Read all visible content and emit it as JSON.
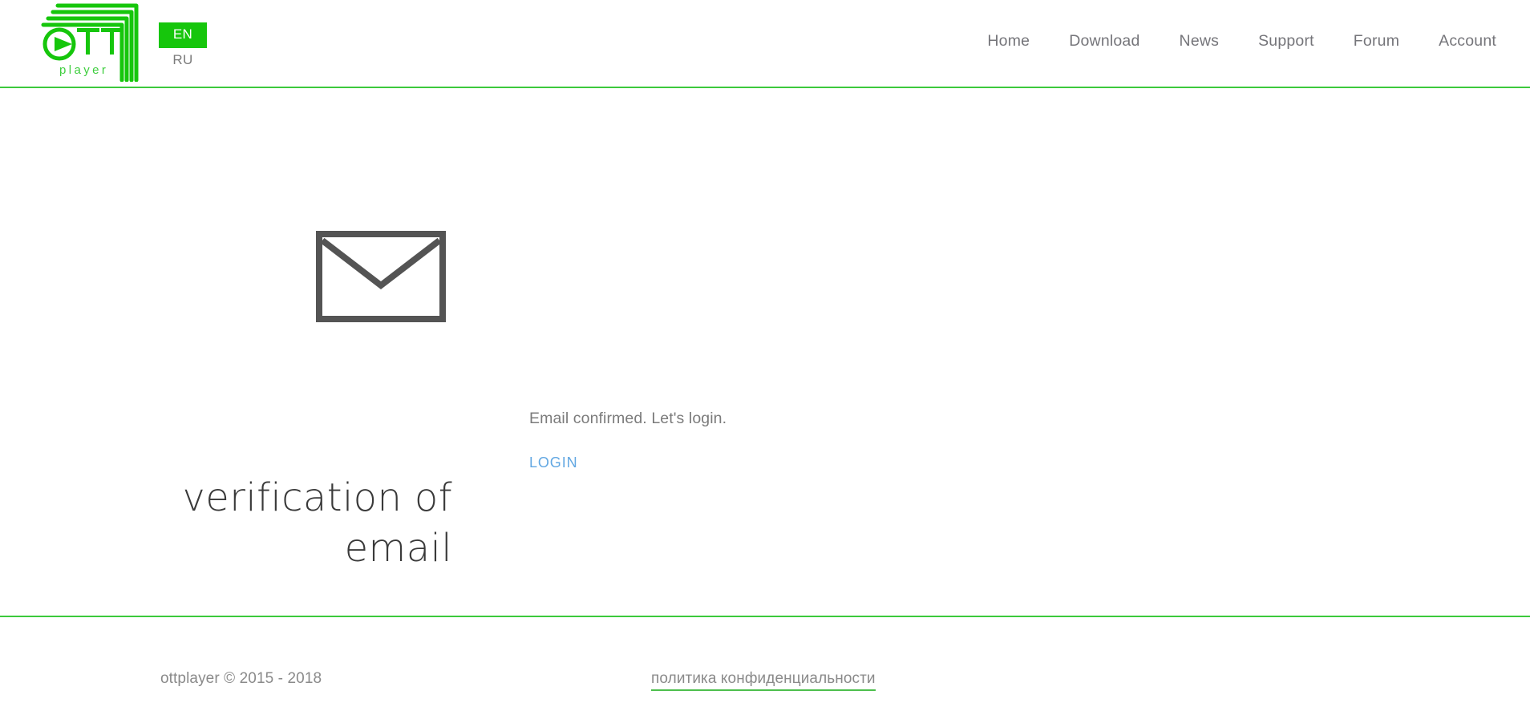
{
  "colors": {
    "brand_green": "#16c60c",
    "rule_green": "#3cc93c",
    "link_blue": "#61a7e2",
    "text_grey": "#7b7b7b",
    "title_grey": "#3a3a3a",
    "icon_grey": "#545454"
  },
  "header": {
    "logo": {
      "name": "ottplayer-logo",
      "wordmark": "OTT",
      "subtext": "player",
      "icon": "play-icon"
    },
    "language_switcher": {
      "name": "language-switcher",
      "active": "EN",
      "options": [
        {
          "code": "EN",
          "label": "EN",
          "active": true
        },
        {
          "code": "RU",
          "label": "RU",
          "active": false
        }
      ]
    },
    "nav": {
      "items": [
        {
          "label": "Home"
        },
        {
          "label": "Download"
        },
        {
          "label": "News"
        },
        {
          "label": "Support"
        },
        {
          "label": "Forum"
        },
        {
          "label": "Account"
        }
      ]
    }
  },
  "main": {
    "icon": "envelope-icon",
    "title_lines": [
      "verification of",
      "email"
    ],
    "status_message": "Email confirmed. Let's login.",
    "login_label": "LOGIN"
  },
  "footer": {
    "copyright": "ottplayer © 2015 - 2018",
    "privacy_label": "политика конфиденциальности"
  }
}
